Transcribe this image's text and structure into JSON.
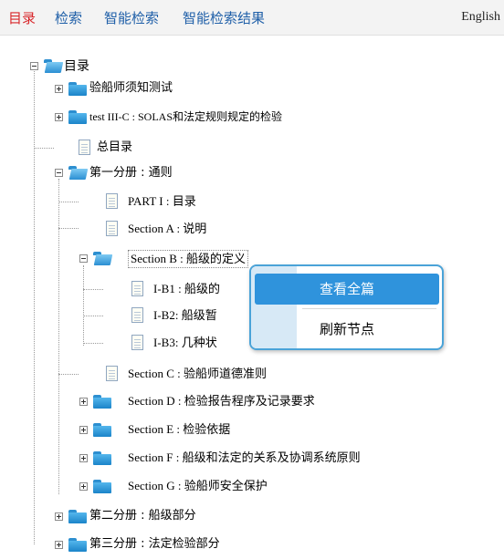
{
  "tabs": [
    {
      "label": "目录",
      "active": true
    },
    {
      "label": "检索",
      "active": false
    },
    {
      "label": "智能检索",
      "active": false
    },
    {
      "label": "智能检索结果",
      "active": false
    }
  ],
  "language_link": "English",
  "tree": {
    "root": "目录",
    "level1": [
      "验船师须知测试",
      "test III-C : SOLAS和法定规则规定的检验",
      "总目录",
      "第一分册 : 通则",
      "第二分册 : 船级部分",
      "第三分册 : 法定检验部分"
    ],
    "volume1_children": [
      "PART I : 目录",
      "Section A : 说明",
      "Section B : 船级的定义",
      "Section C : 验船师道德准则",
      "Section D : 检验报告程序及记录要求",
      "Section E : 检验依据",
      "Section F : 船级和法定的关系及协调系统原则",
      "Section G : 验船师安全保护"
    ],
    "sectionB_children": [
      "I-B1 : 船级的",
      "I-B2: 船级暂",
      "I-B3: 几种状"
    ]
  },
  "context_menu": {
    "items": [
      "查看全篇",
      "刷新节点"
    ],
    "highlighted": "查看全篇"
  },
  "colors": {
    "tab_active": "#d8262a",
    "tab_inactive": "#1f5fa8",
    "menu_highlight": "#2f93dc",
    "menu_border": "#4aa3d8",
    "folder": "#2d8fd0"
  }
}
